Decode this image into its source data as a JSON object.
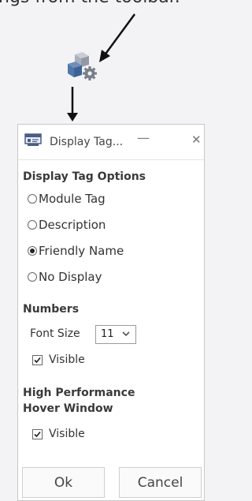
{
  "caption": "ngs from the toolbar.",
  "dialog": {
    "title": "Display Tag...",
    "minimize_glyph": "—",
    "close_glyph": "✕",
    "display_tag_options": {
      "heading": "Display Tag Options",
      "options": [
        "Module Tag",
        "Description",
        "Friendly Name",
        "No Display"
      ],
      "selected": "Friendly Name"
    },
    "numbers": {
      "heading": "Numbers",
      "font_size_label": "Font Size",
      "font_size_value": "11",
      "visible_label": "Visible",
      "visible_checked": true
    },
    "hover_window": {
      "heading_line1": "High Performance",
      "heading_line2": "Hover Window",
      "visible_label": "Visible",
      "visible_checked": true
    },
    "buttons": {
      "ok": "Ok",
      "cancel": "Cancel"
    }
  },
  "icons": {
    "toolbar_button": "display-settings-icon",
    "app_icon": "display-tag-app-icon"
  }
}
